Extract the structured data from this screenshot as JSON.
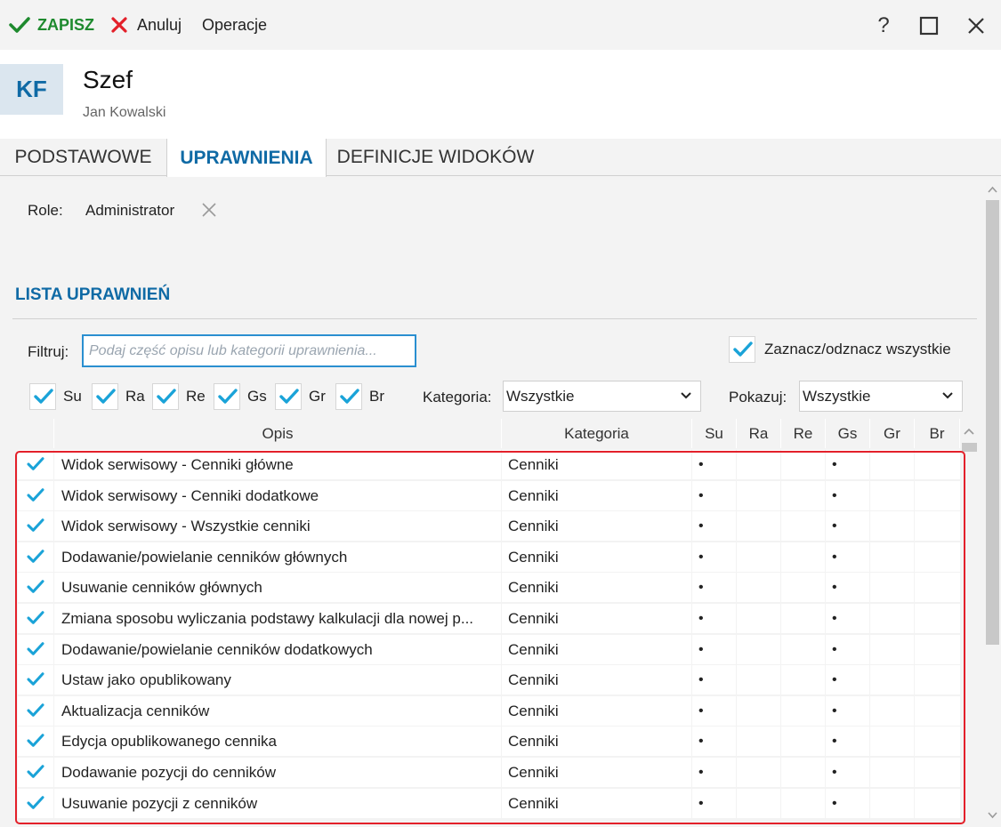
{
  "toolbar": {
    "save_label": "ZAPISZ",
    "cancel_label": "Anuluj",
    "operations_label": "Operacje",
    "help_label": "?"
  },
  "header": {
    "initials": "KF",
    "title": "Szef",
    "subtitle": "Jan Kowalski"
  },
  "tabs": [
    {
      "label": "PODSTAWOWE"
    },
    {
      "label": "UPRAWNIENIA",
      "active": true
    },
    {
      "label": "DEFINICJE WIDOKÓW"
    }
  ],
  "roles": {
    "label": "Role:",
    "value": "Administrator"
  },
  "section": {
    "title": "LISTA UPRAWNIEŃ"
  },
  "filter": {
    "label": "Filtruj:",
    "placeholder": "Podaj część opisu lub kategorii uprawnienia...",
    "value": ""
  },
  "select_all": {
    "label": "Zaznacz/odznacz wszystkie",
    "checked": true
  },
  "flags": [
    {
      "label": "Su",
      "checked": true
    },
    {
      "label": "Ra",
      "checked": true
    },
    {
      "label": "Re",
      "checked": true
    },
    {
      "label": "Gs",
      "checked": true
    },
    {
      "label": "Gr",
      "checked": true
    },
    {
      "label": "Br",
      "checked": true
    }
  ],
  "category_filter": {
    "label": "Kategoria:",
    "value": "Wszystkie"
  },
  "show_filter": {
    "label": "Pokazuj:",
    "value": "Wszystkie"
  },
  "grid": {
    "columns": [
      "",
      "Opis",
      "Kategoria",
      "Su",
      "Ra",
      "Re",
      "Gs",
      "Gr",
      "Br"
    ],
    "rows": [
      {
        "checked": true,
        "opis": "Widok serwisowy - Cenniki główne",
        "kategoria": "Cenniki",
        "flags": [
          "•",
          "",
          "",
          "•",
          "",
          ""
        ]
      },
      {
        "checked": true,
        "opis": "Widok serwisowy - Cenniki dodatkowe",
        "kategoria": "Cenniki",
        "flags": [
          "•",
          "",
          "",
          "•",
          "",
          ""
        ]
      },
      {
        "checked": true,
        "opis": "Widok serwisowy - Wszystkie cenniki",
        "kategoria": "Cenniki",
        "flags": [
          "•",
          "",
          "",
          "•",
          "",
          ""
        ]
      },
      {
        "checked": true,
        "opis": "Dodawanie/powielanie cenników głównych",
        "kategoria": "Cenniki",
        "flags": [
          "•",
          "",
          "",
          "•",
          "",
          ""
        ]
      },
      {
        "checked": true,
        "opis": "Usuwanie cenników głównych",
        "kategoria": "Cenniki",
        "flags": [
          "•",
          "",
          "",
          "•",
          "",
          ""
        ]
      },
      {
        "checked": true,
        "opis": "Zmiana sposobu wyliczania podstawy kalkulacji dla nowej p...",
        "kategoria": "Cenniki",
        "flags": [
          "•",
          "",
          "",
          "•",
          "",
          ""
        ]
      },
      {
        "checked": true,
        "opis": "Dodawanie/powielanie cenników dodatkowych",
        "kategoria": "Cenniki",
        "flags": [
          "•",
          "",
          "",
          "•",
          "",
          ""
        ]
      },
      {
        "checked": true,
        "opis": "Ustaw jako opublikowany",
        "kategoria": "Cenniki",
        "flags": [
          "•",
          "",
          "",
          "•",
          "",
          ""
        ]
      },
      {
        "checked": true,
        "opis": "Aktualizacja cenników",
        "kategoria": "Cenniki",
        "flags": [
          "•",
          "",
          "",
          "•",
          "",
          ""
        ]
      },
      {
        "checked": true,
        "opis": "Edycja opublikowanego cennika",
        "kategoria": "Cenniki",
        "flags": [
          "•",
          "",
          "",
          "•",
          "",
          ""
        ]
      },
      {
        "checked": true,
        "opis": "Dodawanie pozycji do cenników",
        "kategoria": "Cenniki",
        "flags": [
          "•",
          "",
          "",
          "•",
          "",
          ""
        ]
      },
      {
        "checked": true,
        "opis": "Usuwanie pozycji z cenników",
        "kategoria": "Cenniki",
        "flags": [
          "•",
          "",
          "",
          "•",
          "",
          ""
        ]
      }
    ]
  },
  "colors": {
    "accent": "#0f6aa5",
    "save_green": "#1e8a2e",
    "cancel_red": "#e3202a",
    "check_blue": "#1aa3d8",
    "highlight_red": "#e3202a"
  }
}
